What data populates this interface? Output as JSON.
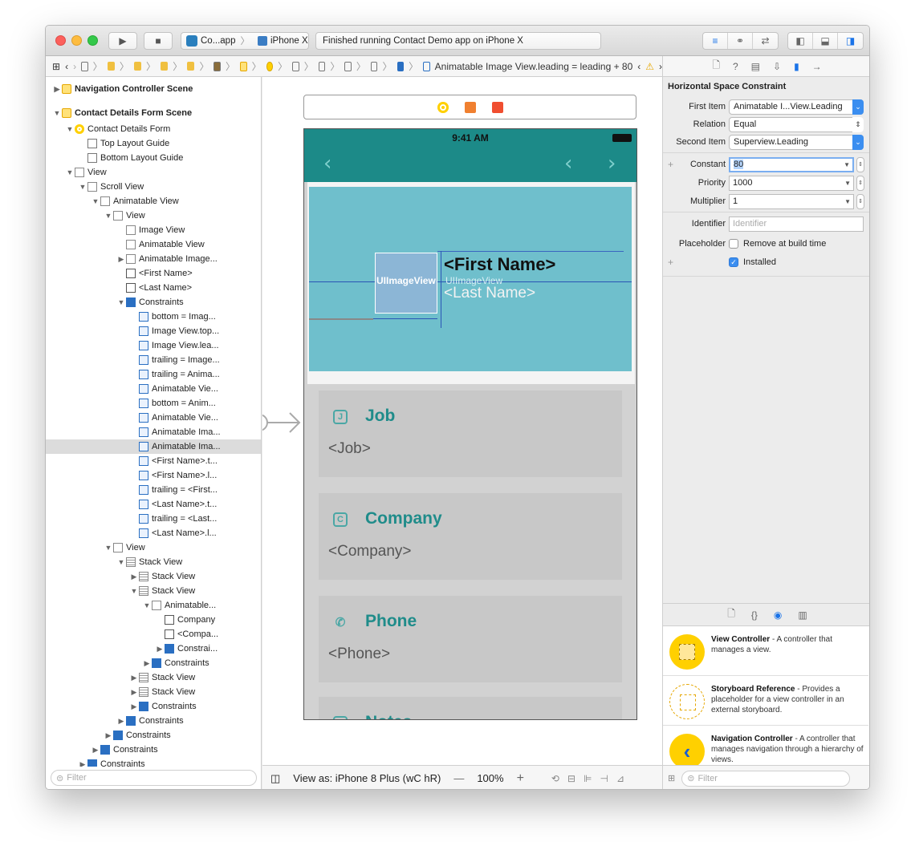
{
  "titlebar": {
    "scheme_app": "Co...app",
    "scheme_device": "iPhone X",
    "activity": "Finished running Contact Demo app on iPhone X"
  },
  "jumpbar": {
    "current": "Animatable Image View.leading = leading + 80"
  },
  "navigator": {
    "filter_placeholder": "Filter",
    "rows": [
      {
        "label": "Navigation Controller Scene"
      },
      {
        "label": "Contact Details Form Scene"
      },
      {
        "label": "Contact Details Form"
      },
      {
        "label": "Top Layout Guide"
      },
      {
        "label": "Bottom Layout Guide"
      },
      {
        "label": "View"
      },
      {
        "label": "Scroll View"
      },
      {
        "label": "Animatable View"
      },
      {
        "label": "View"
      },
      {
        "label": "Image View"
      },
      {
        "label": "Animatable View"
      },
      {
        "label": "Animatable Image..."
      },
      {
        "label": "<First Name>"
      },
      {
        "label": "<Last Name>"
      },
      {
        "label": "Constraints"
      },
      {
        "label": "bottom = Imag..."
      },
      {
        "label": "Image View.top..."
      },
      {
        "label": "Image View.lea..."
      },
      {
        "label": "trailing = Image..."
      },
      {
        "label": "trailing = Anima..."
      },
      {
        "label": "Animatable Vie..."
      },
      {
        "label": "bottom = Anim..."
      },
      {
        "label": "Animatable Vie..."
      },
      {
        "label": "Animatable Ima..."
      },
      {
        "label": "Animatable Ima..."
      },
      {
        "label": "<First Name>.t..."
      },
      {
        "label": "<First Name>.l..."
      },
      {
        "label": "trailing = <First..."
      },
      {
        "label": "<Last Name>.t..."
      },
      {
        "label": "trailing = <Last..."
      },
      {
        "label": "<Last Name>.l..."
      },
      {
        "label": "View"
      },
      {
        "label": "Stack View"
      },
      {
        "label": "Stack View"
      },
      {
        "label": "Stack View"
      },
      {
        "label": "Animatable..."
      },
      {
        "label": "Company"
      },
      {
        "label": "<Compa..."
      },
      {
        "label": "Constrai..."
      },
      {
        "label": "Constraints"
      },
      {
        "label": "Stack View"
      },
      {
        "label": "Stack View"
      },
      {
        "label": "Constraints"
      },
      {
        "label": "Constraints"
      },
      {
        "label": "Constraints"
      },
      {
        "label": "Constraints"
      },
      {
        "label": "Constraints"
      }
    ]
  },
  "canvas": {
    "status_time": "9:41 AM",
    "first_name": "<First Name>",
    "last_name": "<Last Name>",
    "image_placeholder_1": "UIImageView",
    "image_placeholder_2": "UIImageView",
    "cards": [
      {
        "icon": "J",
        "title": "Job",
        "value": "<Job>"
      },
      {
        "icon": "C",
        "title": "Company",
        "value": "<Company>"
      },
      {
        "icon": "✆",
        "title": "Phone",
        "value": "<Phone>"
      },
      {
        "icon": "N",
        "title": "Notes",
        "value": ""
      }
    ],
    "view_as": "View as: iPhone 8 Plus (wC hR)",
    "zoom": "100%"
  },
  "inspector": {
    "title": "Horizontal Space Constraint",
    "first_item_label": "First Item",
    "first_item_value": "Animatable I...View.Leading",
    "relation_label": "Relation",
    "relation_value": "Equal",
    "second_item_label": "Second Item",
    "second_item_value": "Superview.Leading",
    "constant_label": "Constant",
    "constant_value": "80",
    "priority_label": "Priority",
    "priority_value": "1000",
    "multiplier_label": "Multiplier",
    "multiplier_value": "1",
    "identifier_label": "Identifier",
    "identifier_placeholder": "Identifier",
    "placeholder_label": "Placeholder",
    "remove_at_build": "Remove at build time",
    "installed": "Installed"
  },
  "library": {
    "filter_placeholder": "Filter",
    "items": [
      {
        "name": "View Controller",
        "desc": " - A controller that manages a view."
      },
      {
        "name": "Storyboard Reference",
        "desc": " - Provides a placeholder for a view controller in an external storyboard."
      },
      {
        "name": "Navigation Controller",
        "desc": " - A controller that manages navigation through a hierarchy of views."
      }
    ]
  },
  "colors": {
    "navbar": "#1c8a88",
    "header": "#6fbfcc",
    "accent": "#1f8c8a",
    "selection_blue": "#3b8ef0"
  }
}
